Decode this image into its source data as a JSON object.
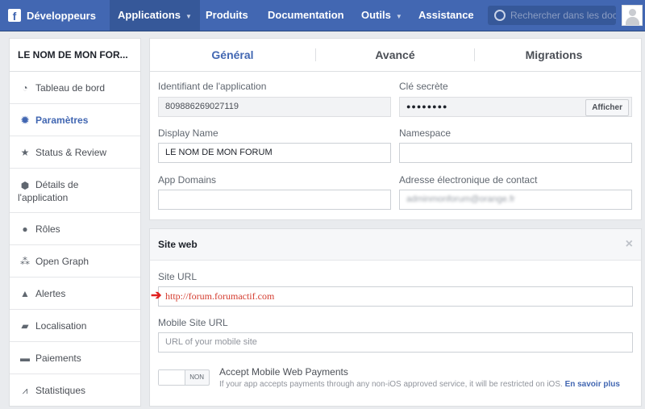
{
  "topbar": {
    "brand": "Développeurs",
    "nav": [
      "Applications",
      "Produits",
      "Documentation",
      "Outils",
      "Assistance"
    ],
    "search_placeholder": "Rechercher dans les docs"
  },
  "sidebar": {
    "title": "LE NOM DE MON FOR...",
    "items": [
      {
        "label": "Tableau de bord",
        "icon": "dashboard-icon"
      },
      {
        "label": "Paramètres",
        "icon": "gear-icon"
      },
      {
        "label": "Status & Review",
        "icon": "star-icon"
      },
      {
        "label": "Détails de l'application",
        "icon": "box-icon"
      },
      {
        "label": "Rôles",
        "icon": "person-icon"
      },
      {
        "label": "Open Graph",
        "icon": "graph-icon"
      },
      {
        "label": "Alertes",
        "icon": "warning-icon"
      },
      {
        "label": "Localisation",
        "icon": "map-icon"
      },
      {
        "label": "Paiements",
        "icon": "card-icon"
      },
      {
        "label": "Statistiques",
        "icon": "chart-icon"
      }
    ]
  },
  "tabs": [
    "Général",
    "Avancé",
    "Migrations"
  ],
  "general": {
    "app_id_label": "Identifiant de l'application",
    "app_id_value": "809886269027119",
    "secret_label": "Clé secrète",
    "secret_value": "●●●●●●●●",
    "show_button": "Afficher",
    "display_name_label": "Display Name",
    "display_name_value": "LE NOM DE MON FORUM",
    "namespace_label": "Namespace",
    "namespace_value": "",
    "app_domains_label": "App Domains",
    "app_domains_value": "",
    "contact_email_label": "Adresse électronique de contact",
    "contact_email_value": "adminmonforum@orange.fr"
  },
  "website": {
    "title": "Site web",
    "site_url_label": "Site URL",
    "site_url_value": "http://forum.forumactif.com",
    "mobile_url_label": "Mobile Site URL",
    "mobile_url_placeholder": "URL of your mobile site",
    "toggle_state": "NON",
    "payments_title": "Accept Mobile Web Payments",
    "payments_desc": "If your app accepts payments through any non-iOS approved service, it will be restricted on iOS.",
    "payments_link": "En savoir plus"
  }
}
